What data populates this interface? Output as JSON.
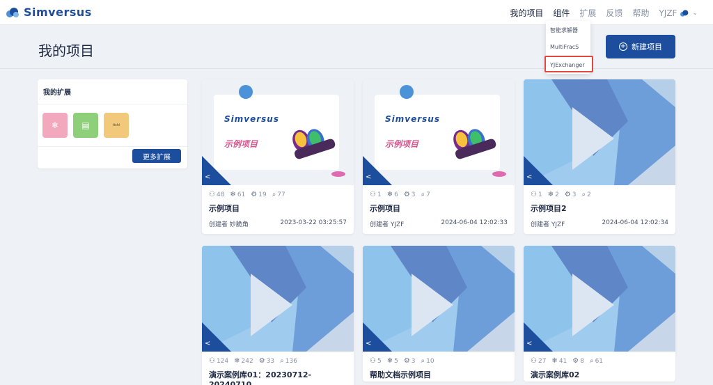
{
  "app": {
    "logo_text": "Simversus"
  },
  "nav": {
    "items": [
      "我的项目",
      "组件",
      "扩展",
      "反馈",
      "帮助"
    ],
    "user": "YJZF"
  },
  "dropdown": {
    "items": [
      "智能求解器",
      "MultiFracS",
      "YJExchanger"
    ],
    "highlighted": "YJExchanger"
  },
  "page": {
    "title": "我的项目",
    "new_button": "新建项目"
  },
  "extensions": {
    "title": "我的扩展",
    "more_button": "更多扩展",
    "tiles": [
      {
        "icon": "snowflake-icon",
        "color": "#f2a8bd"
      },
      {
        "icon": "document-icon",
        "color": "#8ed07a"
      },
      {
        "icon": "tishi",
        "label": "tishi",
        "color": "#f2c97a"
      }
    ]
  },
  "thumb_text": {
    "word": "Simversus",
    "cn": "示例项目"
  },
  "projects": [
    {
      "stats": [
        "48",
        "61",
        "19",
        "77"
      ],
      "title": "示例项目",
      "creator": "创建者 妙脆角",
      "date": "2023-03-22 03:25:57",
      "thumb": "simversus"
    },
    {
      "stats": [
        "1",
        "6",
        "3",
        "7"
      ],
      "title": "示例项目",
      "creator": "创建者 YJZF",
      "date": "2024-06-04 12:02:33",
      "thumb": "simversus"
    },
    {
      "stats": [
        "1",
        "2",
        "3",
        "2"
      ],
      "title": "示例项目2",
      "creator": "创建者 YJZF",
      "date": "2024-06-04 12:02:34",
      "thumb": "geo"
    },
    {
      "stats": [
        "124",
        "242",
        "33",
        "136"
      ],
      "title": "演示案例库01：20230712-20240710",
      "thumb": "geo"
    },
    {
      "stats": [
        "5",
        "5",
        "3",
        "10"
      ],
      "title": "帮助文档示例项目",
      "thumb": "geo"
    },
    {
      "stats": [
        "27",
        "41",
        "8",
        "61"
      ],
      "title": "演示案例库02",
      "thumb": "geo"
    }
  ],
  "colors": {
    "primary": "#1d4e9e",
    "highlight_border": "#e0473e"
  }
}
